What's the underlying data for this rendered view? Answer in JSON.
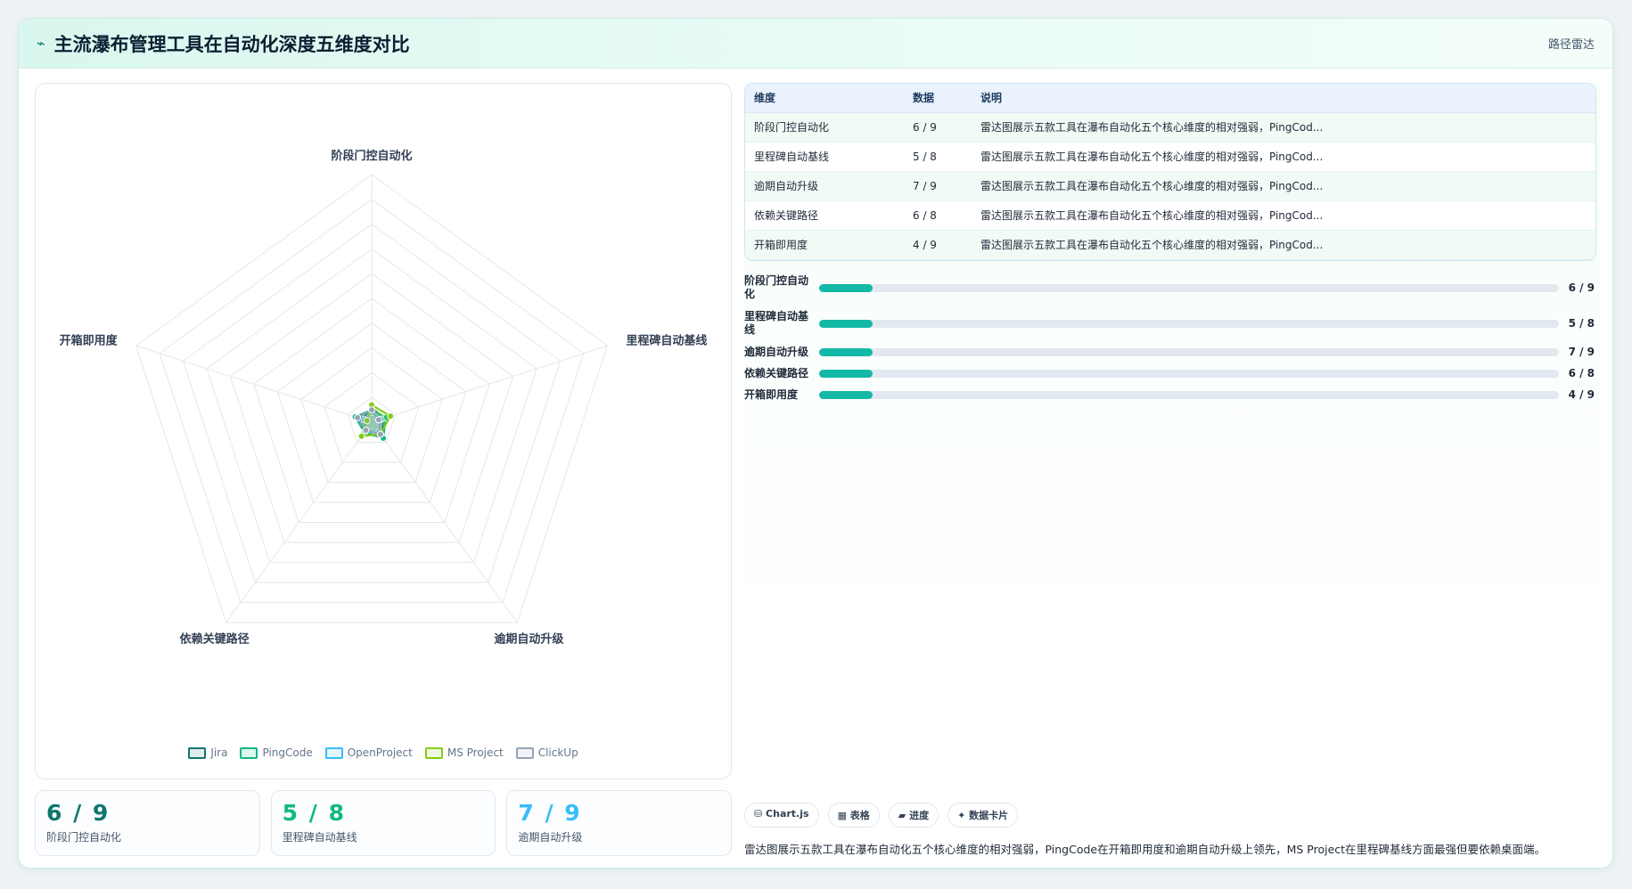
{
  "header": {
    "icon": "chart-line-icon",
    "title": "主流瀑布管理工具在自动化深度五维度对比",
    "tag": "路径雷达"
  },
  "chart_data": {
    "type": "radar",
    "title": "",
    "axes": [
      "阶段门控自动化",
      "里程碑自动基线",
      "逾期自动升级",
      "依赖关键路径",
      "开箱即用度"
    ],
    "rmax": 100,
    "grid_levels": 10,
    "grid": true,
    "legend_position": "bottom",
    "series": [
      {
        "name": "Jira",
        "color": "#0f766e",
        "values": [
          6,
          5,
          7,
          6,
          4
        ]
      },
      {
        "name": "PingCode",
        "color": "#10b981",
        "values": [
          5,
          6,
          8,
          5,
          7
        ]
      },
      {
        "name": "OpenProject",
        "color": "#38bdf8",
        "values": [
          4,
          4,
          5,
          5,
          3
        ]
      },
      {
        "name": "MS Project",
        "color": "#84cc16",
        "values": [
          7,
          8,
          6,
          7,
          2
        ]
      },
      {
        "name": "ClickUp",
        "color": "#94a3b8",
        "values": [
          5,
          3,
          6,
          4,
          6
        ]
      }
    ]
  },
  "stats": [
    {
      "value": "6 / 9",
      "label": "阶段门控自动化",
      "color": "#0f766e"
    },
    {
      "value": "5 / 8",
      "label": "里程碑自动基线",
      "color": "#10b981"
    },
    {
      "value": "7 / 9",
      "label": "逾期自动升级",
      "color": "#38bdf8"
    }
  ],
  "table": {
    "headers": [
      "维度",
      "数据",
      "说明"
    ],
    "rows": [
      [
        "阶段门控自动化",
        "6 / 9",
        "雷达图展示五款工具在瀑布自动化五个核心维度的相对强弱，PingCod..."
      ],
      [
        "里程碑自动基线",
        "5 / 8",
        "雷达图展示五款工具在瀑布自动化五个核心维度的相对强弱，PingCod..."
      ],
      [
        "逾期自动升级",
        "7 / 9",
        "雷达图展示五款工具在瀑布自动化五个核心维度的相对强弱，PingCod..."
      ],
      [
        "依赖关键路径",
        "6 / 8",
        "雷达图展示五款工具在瀑布自动化五个核心维度的相对强弱，PingCod..."
      ],
      [
        "开箱即用度",
        "4 / 9",
        "雷达图展示五款工具在瀑布自动化五个核心维度的相对强弱，PingCod..."
      ]
    ]
  },
  "bars": [
    {
      "label": "阶段门控自动化",
      "value": "6 / 9",
      "fraction": 0.072
    },
    {
      "label": "里程碑自动基线",
      "value": "5 / 8",
      "fraction": 0.072
    },
    {
      "label": "逾期自动升级",
      "value": "7 / 9",
      "fraction": 0.072
    },
    {
      "label": "依赖关键路径",
      "value": "6 / 8",
      "fraction": 0.072
    },
    {
      "label": "开箱即用度",
      "value": "4 / 9",
      "fraction": 0.072
    }
  ],
  "chips": [
    "⛁ Chart.js",
    "▦ 表格",
    "▰ 进度",
    "✦ 数据卡片"
  ],
  "summary": "雷达图展示五款工具在瀑布自动化五个核心维度的相对强弱，PingCode在开箱即用度和逾期自动升级上领先，MS Project在里程碑基线方面最强但要依赖桌面端。"
}
